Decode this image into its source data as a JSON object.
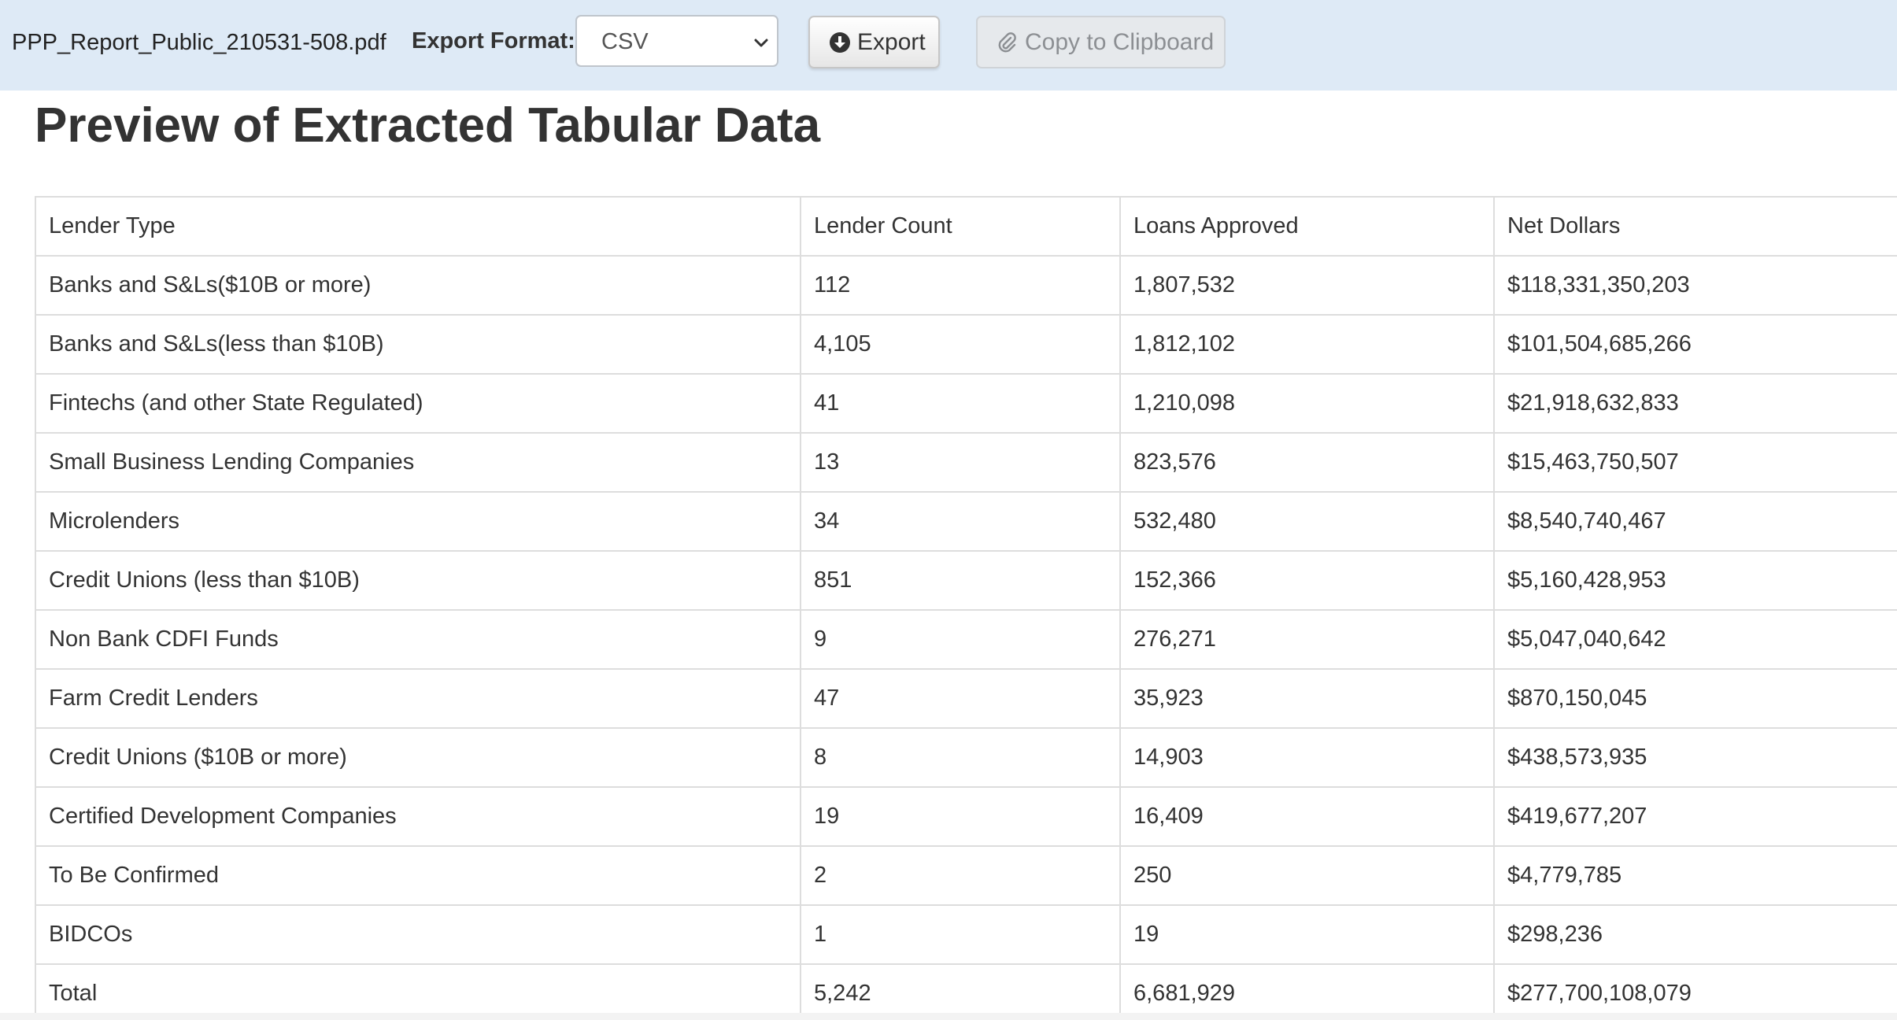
{
  "toolbar": {
    "filename": "PPP_Report_Public_210531-508.pdf",
    "export_format_label": "Export Format:",
    "export_format_value": "CSV",
    "export_button": "Export",
    "copy_button": "Copy to Clipboard"
  },
  "page": {
    "title": "Preview of Extracted Tabular Data"
  },
  "table": {
    "headers": [
      "Lender Type",
      "Lender Count",
      "Loans Approved",
      "Net Dollars"
    ],
    "rows": [
      [
        "Banks and S&Ls($10B or more)",
        "112",
        "1,807,532",
        "$118,331,350,203"
      ],
      [
        "Banks and S&Ls(less than $10B)",
        "4,105",
        "1,812,102",
        "$101,504,685,266"
      ],
      [
        "Fintechs (and other State Regulated)",
        "41",
        "1,210,098",
        "$21,918,632,833"
      ],
      [
        "Small Business Lending Companies",
        "13",
        "823,576",
        "$15,463,750,507"
      ],
      [
        "Microlenders",
        "34",
        "532,480",
        "$8,540,740,467"
      ],
      [
        "Credit Unions (less than $10B)",
        "851",
        "152,366",
        "$5,160,428,953"
      ],
      [
        "Non Bank CDFI Funds",
        "9",
        "276,271",
        "$5,047,040,642"
      ],
      [
        "Farm Credit Lenders",
        "47",
        "35,923",
        "$870,150,045"
      ],
      [
        "Credit Unions ($10B or more)",
        "8",
        "14,903",
        "$438,573,935"
      ],
      [
        "Certified Development Companies",
        "19",
        "16,409",
        "$419,677,207"
      ],
      [
        "To Be Confirmed",
        "2",
        "250",
        "$4,779,785"
      ],
      [
        "BIDCOs",
        "1",
        "19",
        "$298,236"
      ],
      [
        "Total",
        "5,242",
        "6,681,929",
        "$277,700,108,079"
      ]
    ]
  },
  "colors": {
    "toolbar_background": "#deeaf6",
    "table_border": "#dddddd"
  },
  "icons": {
    "format_dropdown": "chevron-down-icon",
    "export": "download-circle-icon",
    "copy": "paperclip-icon"
  }
}
